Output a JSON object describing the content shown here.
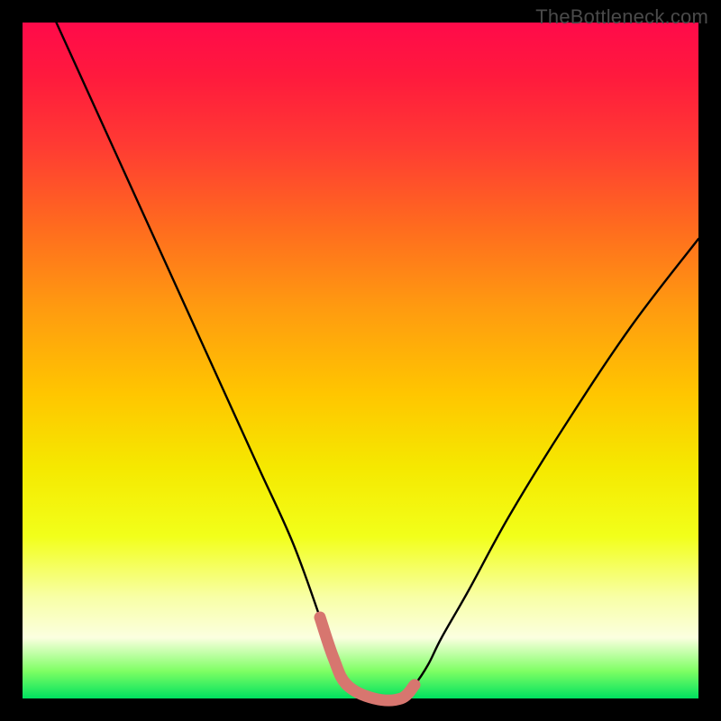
{
  "watermark": "TheBottleneck.com",
  "chart_data": {
    "type": "line",
    "title": "",
    "xlabel": "",
    "ylabel": "",
    "xlim": [
      0,
      100
    ],
    "ylim": [
      0,
      100
    ],
    "series": [
      {
        "name": "curve",
        "x": [
          5,
          10,
          15,
          20,
          25,
          30,
          35,
          40,
          44,
          46,
          48,
          52,
          56,
          58,
          60,
          62,
          66,
          72,
          80,
          90,
          100
        ],
        "y": [
          100,
          89,
          78,
          67,
          56,
          45,
          34,
          23,
          12,
          6,
          2,
          0,
          0,
          2,
          5,
          9,
          16,
          27,
          40,
          55,
          68
        ]
      },
      {
        "name": "highlight",
        "x": [
          44,
          46,
          48,
          52,
          56,
          58
        ],
        "y": [
          12,
          6,
          2,
          0,
          0,
          2
        ]
      }
    ],
    "colors": {
      "curve": "#000000",
      "highlight": "#d7766f"
    }
  }
}
